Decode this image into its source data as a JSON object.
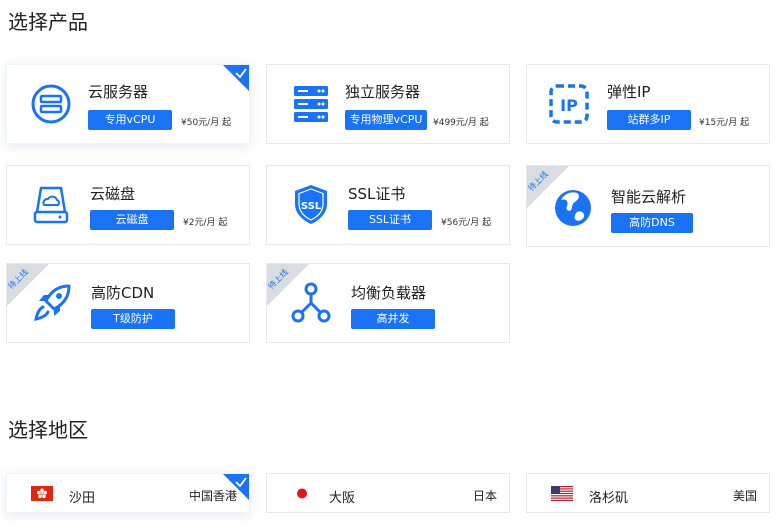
{
  "sections": {
    "products_title": "选择产品",
    "region_title": "选择地区"
  },
  "colors": {
    "accent": "#1a73f5",
    "ribbon_gray": "#d9dce1",
    "card_border": "#e6e8ec"
  },
  "products": [
    {
      "name": "云服务器",
      "tag": "专用vCPU",
      "price": "¥50元/月 起",
      "icon": "cloud-server-icon",
      "selected": true
    },
    {
      "name": "独立服务器",
      "tag": "专用物理vCPU",
      "price": "¥499元/月 起",
      "icon": "dedicated-server-icon"
    },
    {
      "name": "弹性IP",
      "tag": "站群多IP",
      "price": "¥15元/月 起",
      "icon": "elastic-ip-icon"
    },
    {
      "name": "云磁盘",
      "tag": "云磁盘",
      "price": "¥2元/月 起",
      "icon": "cloud-disk-icon"
    },
    {
      "name": "SSL证书",
      "tag": "SSL证书",
      "price": "¥56元/月 起",
      "icon": "ssl-shield-icon",
      "icon_text": "SSL"
    },
    {
      "name": "智能云解析",
      "tag": "高防DNS",
      "icon": "globe-icon",
      "badge": "待上线"
    },
    {
      "name": "高防CDN",
      "tag": "T级防护",
      "icon": "rocket-icon",
      "badge": "待上线"
    },
    {
      "name": "均衡负载器",
      "tag": "高并发",
      "icon": "load-balancer-icon",
      "badge": "待上线"
    }
  ],
  "regions": [
    {
      "city": "沙田",
      "country": "中国香港",
      "flag": "hong-kong-flag-icon",
      "selected": true
    },
    {
      "city": "大阪",
      "country": "日本",
      "flag": "japan-flag-icon"
    },
    {
      "city": "洛杉矶",
      "country": "美国",
      "flag": "usa-flag-icon"
    }
  ]
}
